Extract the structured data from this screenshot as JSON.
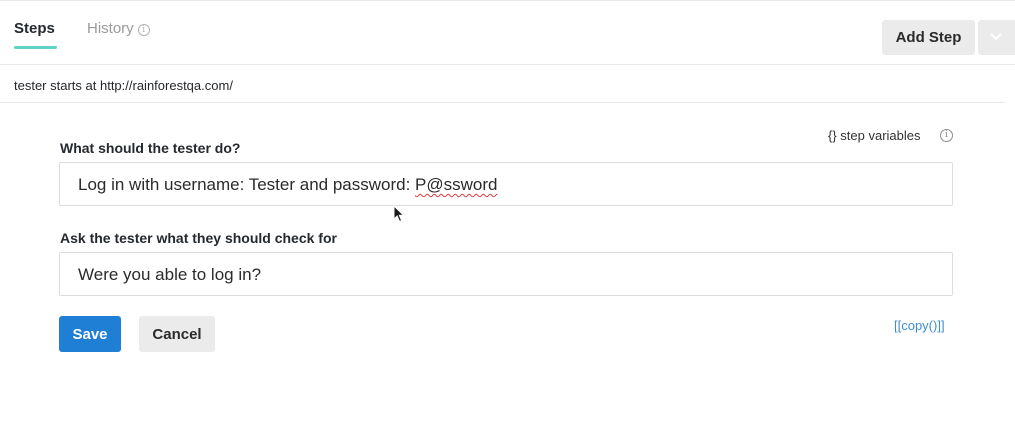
{
  "tabs": {
    "steps_label": "Steps",
    "history_label": "History",
    "history_info_icon": "ⓘ"
  },
  "toolbar": {
    "add_step_label": "Add Step",
    "dropdown_icon": "chevron-down-icon"
  },
  "start": {
    "text": "tester starts at http://rainforestqa.com/"
  },
  "step_variables": {
    "label": "{} step variables",
    "info_icon": "ⓘ"
  },
  "action": {
    "label": "What should the tester do?",
    "value_prefix": "Log in with username: Tester and password: ",
    "value_flagged": "P@ssword"
  },
  "check": {
    "label": "Ask the tester what they should check for",
    "value": "Were you able to log in?"
  },
  "buttons": {
    "save_label": "Save",
    "cancel_label": "Cancel",
    "copy_label": "[[copy()]]"
  },
  "colors": {
    "accent_tab": "#5fd3c3",
    "primary": "#1f7fd4",
    "link": "#3d8fd1"
  }
}
